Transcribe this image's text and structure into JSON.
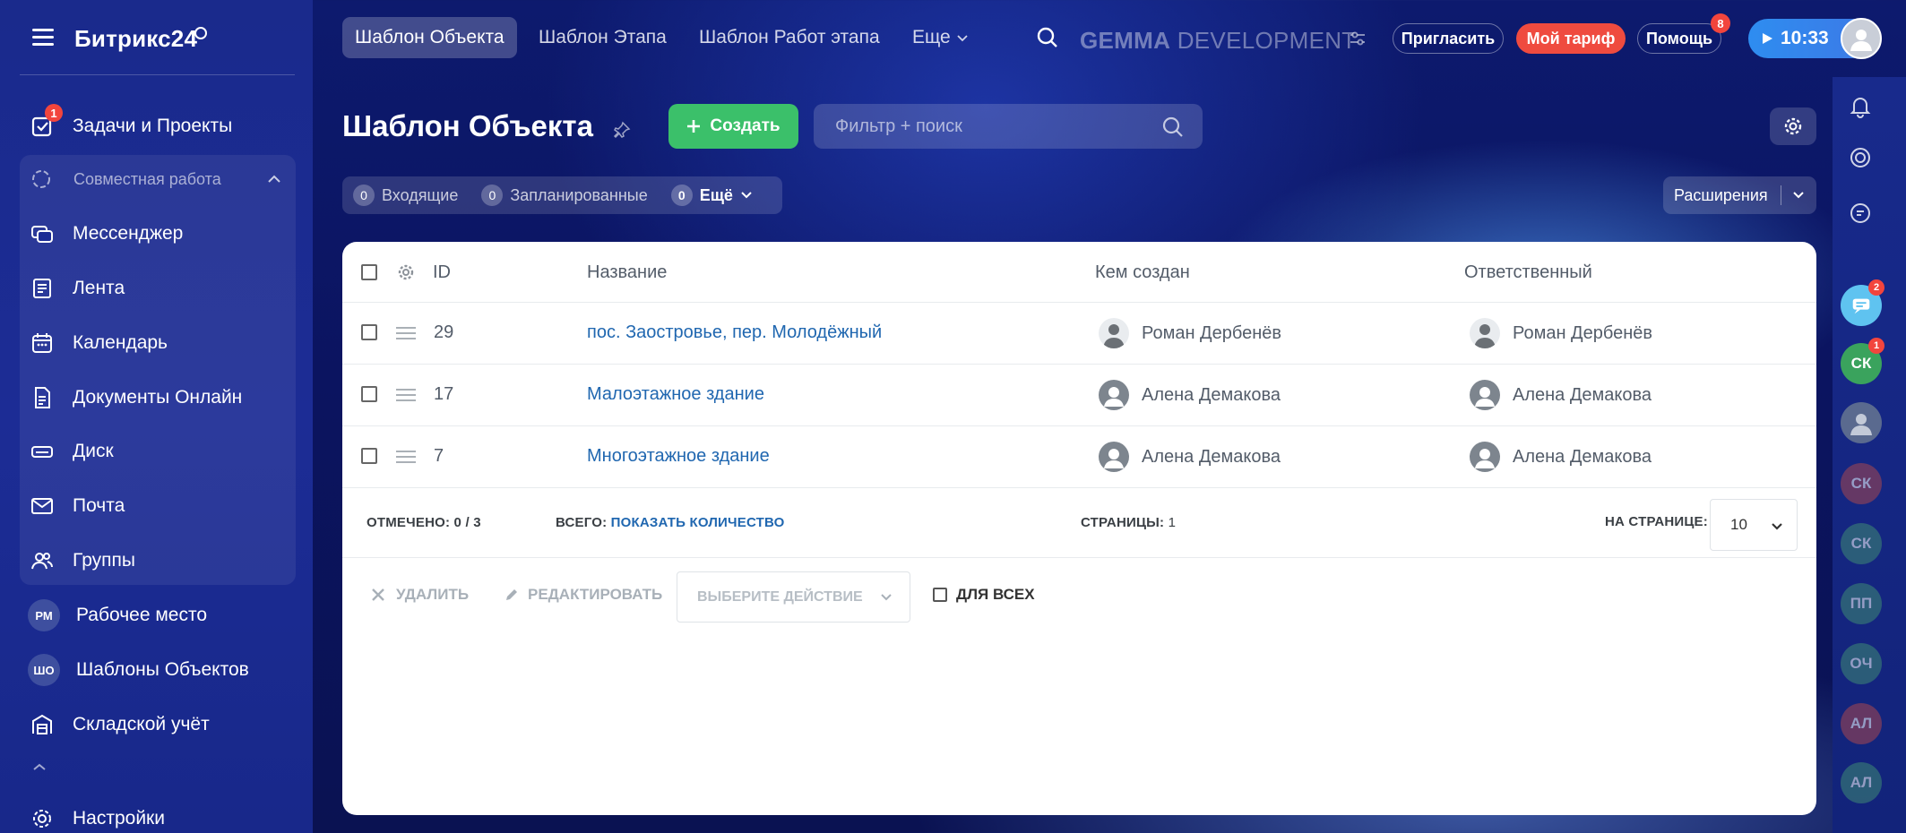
{
  "app": {
    "logo": "Битрикс24"
  },
  "sidebar": {
    "tasks": {
      "label": "Задачи и Проекты",
      "badge": "1"
    },
    "group_title": "Совместная работа",
    "items": [
      {
        "label": "Мессенджер",
        "icon": "messenger-icon"
      },
      {
        "label": "Лента",
        "icon": "feed-icon"
      },
      {
        "label": "Календарь",
        "icon": "calendar-icon"
      },
      {
        "label": "Документы Онлайн",
        "icon": "documents-icon"
      },
      {
        "label": "Диск",
        "icon": "disk-icon"
      },
      {
        "label": "Почта",
        "icon": "mail-icon"
      },
      {
        "label": "Группы",
        "icon": "groups-icon"
      }
    ],
    "workplace": {
      "label": "Рабочее место",
      "avatar": "РМ"
    },
    "templates": {
      "label": "Шаблоны Объектов",
      "avatar": "ШО"
    },
    "warehouse": {
      "label": "Складской учёт"
    },
    "settings": {
      "label": "Настройки"
    }
  },
  "topbar": {
    "tabs": [
      "Шаблон Объекта",
      "Шаблон Этапа",
      "Шаблон Работ этапа"
    ],
    "more": "Еще",
    "company": "GEMMA DEVELOPMENT",
    "company_bold": "GEMMA",
    "company_rest": "DEVELOPMENT",
    "invite": "Пригласить",
    "tariff": "Мой тариф",
    "help": "Помощь",
    "help_badge": "8",
    "time": "10:33"
  },
  "page": {
    "title": "Шаблон Объекта",
    "create": "Создать",
    "search_placeholder": "Фильтр + поиск",
    "counters": [
      {
        "num": "0",
        "label": "Входящие"
      },
      {
        "num": "0",
        "label": "Запланированные"
      },
      {
        "num": "0",
        "label": "Ещё"
      }
    ],
    "extensions": "Расширения"
  },
  "grid": {
    "columns": {
      "id": "ID",
      "name": "Название",
      "created_by": "Кем создан",
      "responsible": "Ответственный"
    },
    "rows": [
      {
        "id": "29",
        "name": "пос. Заостровье, пер. Молодёжный",
        "created_by": "Роман Дербенёв",
        "responsible": "Роман Дербенёв"
      },
      {
        "id": "17",
        "name": "Малоэтажное здание",
        "created_by": "Алена Демакова",
        "responsible": "Алена Демакова"
      },
      {
        "id": "7",
        "name": "Многоэтажное здание",
        "created_by": "Алена Демакова",
        "responsible": "Алена Демакова"
      }
    ],
    "footer": {
      "checked_label": "ОТМЕЧЕНО:",
      "checked_value": "0 / 3",
      "total_label": "ВСЕГО:",
      "total_link": "ПОКАЗАТЬ КОЛИЧЕСТВО",
      "pages_label": "СТРАНИЦЫ:",
      "pages_value": "1",
      "per_page_label": "НА СТРАНИЦЕ:",
      "per_page_value": "10"
    },
    "actions": {
      "delete": "УДАЛИТЬ",
      "edit": "РЕДАКТИРОВАТЬ",
      "choose": "ВЫБЕРИТЕ ДЕЙСТВИЕ",
      "for_all": "ДЛЯ ВСЕХ"
    }
  },
  "rail": {
    "chat_badge": "2",
    "avatars": [
      {
        "initials": "СК",
        "color": "#3aa35d",
        "badge": "1"
      },
      {
        "initials": "",
        "color": "#5a6a8f",
        "badge": ""
      },
      {
        "initials": "СК",
        "color": "#a8474f",
        "badge": ""
      },
      {
        "initials": "СК",
        "color": "#3f8b74",
        "badge": ""
      },
      {
        "initials": "ПП",
        "color": "#3f8b74",
        "badge": ""
      },
      {
        "initials": "ОЧ",
        "color": "#3f8b74",
        "badge": ""
      },
      {
        "initials": "АЛ",
        "color": "#a8474f",
        "badge": ""
      },
      {
        "initials": "АЛ",
        "color": "#3f8b74",
        "badge": ""
      }
    ]
  },
  "colors": {
    "accent_green": "#3bc06a",
    "link": "#2067b0",
    "badge_red": "#f2453d",
    "tariff_red": "#ef4b3f",
    "time_blue": "#2e8df0"
  }
}
